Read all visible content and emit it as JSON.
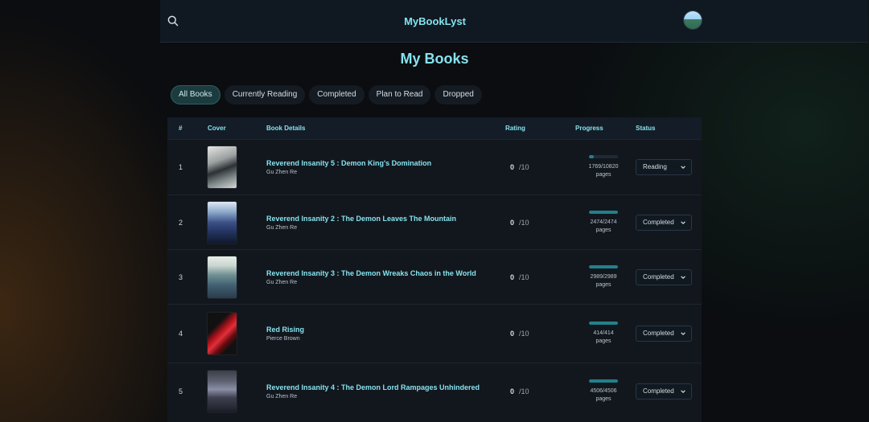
{
  "app": {
    "brand": "MyBookLyst"
  },
  "page": {
    "title": "My Books"
  },
  "tabs": [
    {
      "label": "All Books",
      "active": true
    },
    {
      "label": "Currently Reading",
      "active": false
    },
    {
      "label": "Completed",
      "active": false
    },
    {
      "label": "Plan to Read",
      "active": false
    },
    {
      "label": "Dropped",
      "active": false
    }
  ],
  "table": {
    "headers": {
      "index": "#",
      "cover": "Cover",
      "details": "Book Details",
      "rating": "Rating",
      "progress": "Progress",
      "status": "Status"
    },
    "rows": [
      {
        "index": "1",
        "title": "Reverend Insanity 5 : Demon King's Domination",
        "author": "Gu Zhen Re",
        "rating": "0",
        "rating_max": "/10",
        "progress_pages": "1769/10820",
        "progress_unit": "pages",
        "progress_fraction": 0.1635,
        "status": "Reading"
      },
      {
        "index": "2",
        "title": "Reverend Insanity 2 : The Demon Leaves The Mountain",
        "author": "Gu Zhen Re",
        "rating": "0",
        "rating_max": "/10",
        "progress_pages": "2474/2474",
        "progress_unit": "pages",
        "progress_fraction": 1.0,
        "status": "Completed"
      },
      {
        "index": "3",
        "title": "Reverend Insanity 3 : The Demon Wreaks Chaos in the World",
        "author": "Gu Zhen Re",
        "rating": "0",
        "rating_max": "/10",
        "progress_pages": "2989/2989",
        "progress_unit": "pages",
        "progress_fraction": 1.0,
        "status": "Completed"
      },
      {
        "index": "4",
        "title": "Red Rising",
        "author": "Pierce Brown",
        "rating": "0",
        "rating_max": "/10",
        "progress_pages": "414/414",
        "progress_unit": "pages",
        "progress_fraction": 1.0,
        "status": "Completed"
      },
      {
        "index": "5",
        "title": "Reverend Insanity 4 : The Demon Lord Rampages Unhindered",
        "author": "Gu Zhen Re",
        "rating": "0",
        "rating_max": "/10",
        "progress_pages": "4506/4506",
        "progress_unit": "pages",
        "progress_fraction": 1.0,
        "status": "Completed"
      }
    ]
  },
  "colors": {
    "accent": "#86e3ee",
    "progress_fill": "#24808a",
    "panel": "#12171e",
    "header_bg": "#141c27"
  },
  "icons": {
    "search": "search-icon",
    "avatar": "avatar",
    "chevron": "chevron-down-icon"
  }
}
